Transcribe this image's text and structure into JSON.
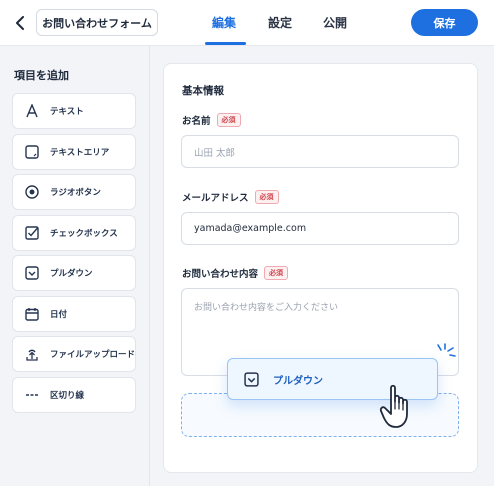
{
  "header": {
    "form_title": "お問い合わせフォーム",
    "tabs": [
      {
        "label": "編集",
        "active": true
      },
      {
        "label": "設定",
        "active": false
      },
      {
        "label": "公開",
        "active": false
      }
    ],
    "save_label": "保存"
  },
  "sidebar": {
    "title": "項目を追加",
    "items": [
      {
        "label": "テキスト",
        "icon": "text-icon"
      },
      {
        "label": "テキストエリア",
        "icon": "textarea-icon"
      },
      {
        "label": "ラジオボタン",
        "icon": "radio-icon"
      },
      {
        "label": "チェックボックス",
        "icon": "checkbox-icon"
      },
      {
        "label": "プルダウン",
        "icon": "dropdown-icon"
      },
      {
        "label": "日付",
        "icon": "calendar-icon"
      },
      {
        "label": "ファイルアップロード",
        "icon": "upload-icon"
      },
      {
        "label": "区切り線",
        "icon": "divider-icon"
      }
    ]
  },
  "form": {
    "section_title": "基本情報",
    "required_badge": "必須",
    "fields": [
      {
        "label": "お名前",
        "placeholder": "山田 太郎",
        "value": ""
      },
      {
        "label": "メールアドレス",
        "placeholder": "",
        "value": "yamada@example.com"
      },
      {
        "label": "お問い合わせ内容",
        "placeholder": "お問い合わせ内容をご入力ください",
        "value": ""
      }
    ]
  },
  "drag": {
    "label": "プルダウン",
    "icon": "dropdown-icon"
  },
  "colors": {
    "accent": "#1e6fe0",
    "required": "#d0454c",
    "background": "#f2f4f8"
  }
}
